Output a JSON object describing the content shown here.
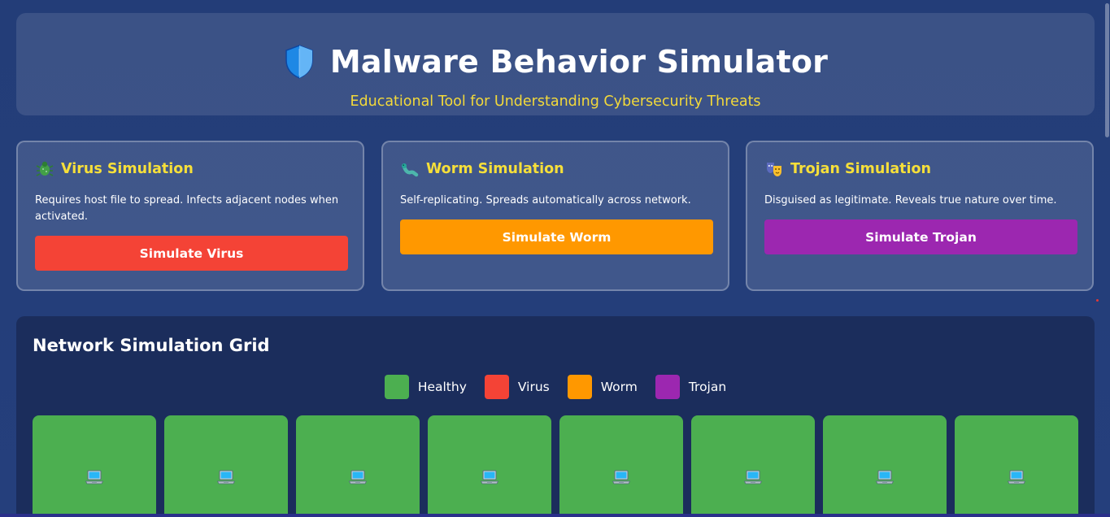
{
  "header": {
    "title": "Malware Behavior Simulator",
    "subtitle": "Educational Tool for Understanding Cybersecurity Threats",
    "icon": "shield-icon"
  },
  "cards": [
    {
      "icon": "bug-icon",
      "title": "Virus Simulation",
      "description": "Requires host file to spread. Infects adjacent nodes when activated.",
      "button_label": "Simulate Virus",
      "color": "#f44336"
    },
    {
      "icon": "worm-icon",
      "title": "Worm Simulation",
      "description": "Self-replicating. Spreads automatically across network.",
      "button_label": "Simulate Worm",
      "color": "#ff9800"
    },
    {
      "icon": "theater-masks-icon",
      "title": "Trojan Simulation",
      "description": "Disguised as legitimate. Reveals true nature over time.",
      "button_label": "Simulate Trojan",
      "color": "#9c27b0"
    }
  ],
  "grid": {
    "title": "Network Simulation Grid",
    "legend": [
      {
        "label": "Healthy",
        "color": "#4caf50"
      },
      {
        "label": "Virus",
        "color": "#f44336"
      },
      {
        "label": "Worm",
        "color": "#ff9800"
      },
      {
        "label": "Trojan",
        "color": "#9c27b0"
      }
    ],
    "nodes": [
      {
        "status": "healthy",
        "icon": "laptop-icon"
      },
      {
        "status": "healthy",
        "icon": "laptop-icon"
      },
      {
        "status": "healthy",
        "icon": "laptop-icon"
      },
      {
        "status": "healthy",
        "icon": "laptop-icon"
      },
      {
        "status": "healthy",
        "icon": "laptop-icon"
      },
      {
        "status": "healthy",
        "icon": "laptop-icon"
      },
      {
        "status": "healthy",
        "icon": "laptop-icon"
      },
      {
        "status": "healthy",
        "icon": "laptop-icon"
      }
    ]
  },
  "colors": {
    "accent_yellow": "#f3d93a",
    "healthy": "#4caf50"
  }
}
